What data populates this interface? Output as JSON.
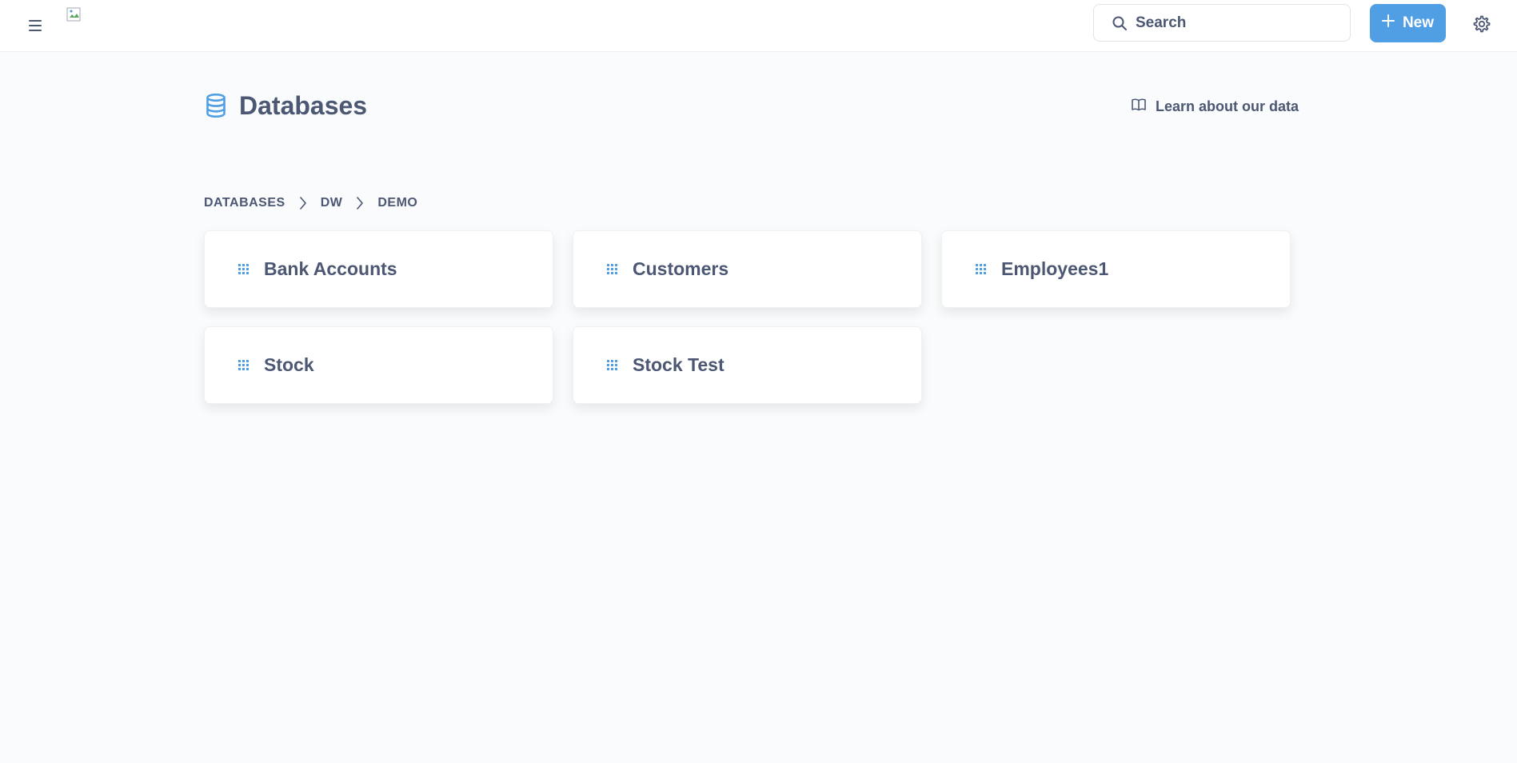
{
  "topbar": {
    "menu_icon": "hamburger-icon",
    "logo_icon": "broken-image-icon",
    "search": {
      "placeholder": "Search",
      "icon": "search-icon"
    },
    "new_button": {
      "label": "New",
      "icon": "plus-icon"
    },
    "settings_icon": "gear-icon"
  },
  "header": {
    "title": "Databases",
    "icon": "database-icon",
    "learn_link": {
      "label": "Learn about our data",
      "icon": "book-icon"
    }
  },
  "breadcrumb": {
    "items": [
      "DATABASES",
      "DW",
      "DEMO"
    ],
    "separator_icon": "chevron-right-icon"
  },
  "tables": [
    {
      "name": "Bank Accounts",
      "icon": "table-grid-icon"
    },
    {
      "name": "Customers",
      "icon": "table-grid-icon"
    },
    {
      "name": "Employees1",
      "icon": "table-grid-icon"
    },
    {
      "name": "Stock",
      "icon": "table-grid-icon"
    },
    {
      "name": "Stock Test",
      "icon": "table-grid-icon"
    }
  ],
  "colors": {
    "accent": "#509ee3",
    "text": "#4c5773",
    "background": "#f9fbfc",
    "card": "#ffffff"
  }
}
